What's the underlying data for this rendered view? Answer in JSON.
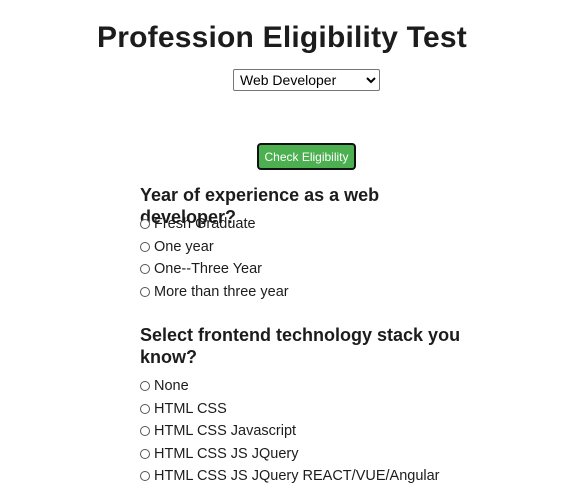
{
  "title": "Profession Eligibility Test",
  "profession_select": {
    "selected": "Web Developer"
  },
  "check_button": {
    "label": "Check Eligibility",
    "color": "#4caf50"
  },
  "questions": [
    {
      "text": "Year of experience as a web developer?",
      "options": [
        "Fresh Graduate",
        "One year",
        "One--Three Year",
        "More than three year"
      ]
    },
    {
      "text": "Select frontend technology stack you know?",
      "options": [
        "None",
        "HTML CSS",
        "HTML CSS Javascript",
        "HTML CSS JS JQuery",
        "HTML CSS JS JQuery REACT/VUE/Angular"
      ]
    }
  ]
}
